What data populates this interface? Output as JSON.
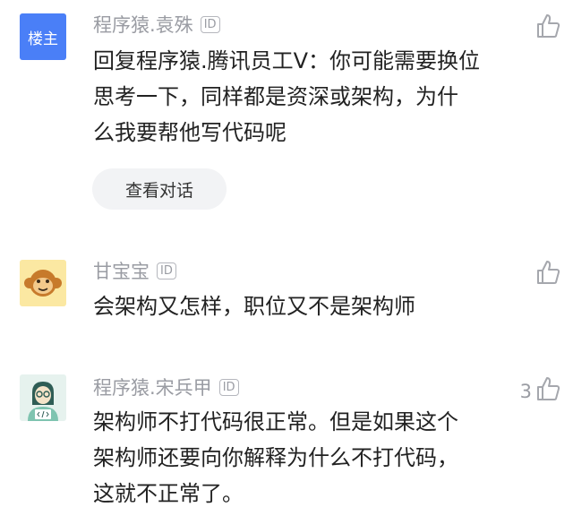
{
  "comments": [
    {
      "avatar_text": "楼主",
      "avatar_color": "#4a7ff7",
      "username": "程序猿.袁殊",
      "id_label": "ID",
      "lines": [
        "回复程序猿.腾讯员工V：你可能需要换位",
        "思考一下，同样都是资深或架构，为什",
        "么我要帮他写代码呢"
      ],
      "action": "查看对话",
      "like_icon": "thumbs-up-icon"
    },
    {
      "avatar_icon": "monkey-face-icon",
      "avatar_color": "#fbe8a2",
      "username": "甘宝宝",
      "id_label": "ID",
      "lines": [
        "会架构又怎样，职位又不是架构师"
      ],
      "like_icon": "thumbs-up-icon"
    },
    {
      "avatar_icon": "programmer-icon",
      "avatar_color": "#e6f2ee",
      "username": "程序猿.宋兵甲",
      "id_label": "ID",
      "lines": [
        "架构师不打代码很正常。但是如果这个",
        "架构师还要向你解释为什么不打代码，",
        "这就不正常了。"
      ],
      "like_count": "3",
      "like_icon": "thumbs-up-icon"
    }
  ]
}
